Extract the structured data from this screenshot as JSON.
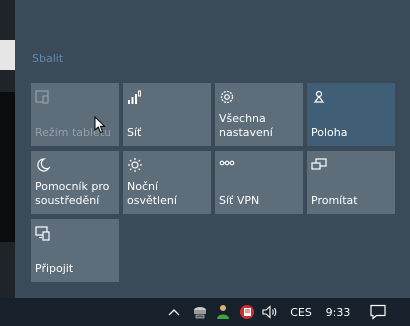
{
  "action_center": {
    "collapse_label": "Sbalit",
    "tiles": [
      {
        "label": "Režim tabletu",
        "icon": "tablet-mode-icon",
        "state": "disabled"
      },
      {
        "label": "Síť",
        "icon": "network-icon",
        "state": "normal"
      },
      {
        "label": "Všechna nastavení",
        "icon": "settings-gear-icon",
        "state": "normal"
      },
      {
        "label": "Poloha",
        "icon": "location-icon",
        "state": "active"
      },
      {
        "label": "Pomocník pro soustředění",
        "icon": "focus-assist-moon-icon",
        "state": "normal"
      },
      {
        "label": "Noční osvětlení",
        "icon": "night-light-sun-icon",
        "state": "normal"
      },
      {
        "label": "Síť VPN",
        "icon": "vpn-icon",
        "state": "normal"
      },
      {
        "label": "Promítat",
        "icon": "project-icon",
        "state": "normal"
      },
      {
        "label": "Připojit",
        "icon": "connect-icon",
        "state": "normal"
      }
    ]
  },
  "taskbar": {
    "language": "CES",
    "time": "9:33",
    "tray_icons": [
      "chevron-up-icon",
      "network-drive-icon",
      "user-green-icon",
      "red-badge-app-icon",
      "speaker-icon"
    ],
    "notification_icon": "action-center-notification-icon"
  },
  "colors": {
    "panel_bg": "#3a4a58",
    "tile_bg": "#5d6d7a",
    "tile_active": "#415e77",
    "taskbar_bg": "#16212b",
    "link": "#5f8bb0"
  }
}
